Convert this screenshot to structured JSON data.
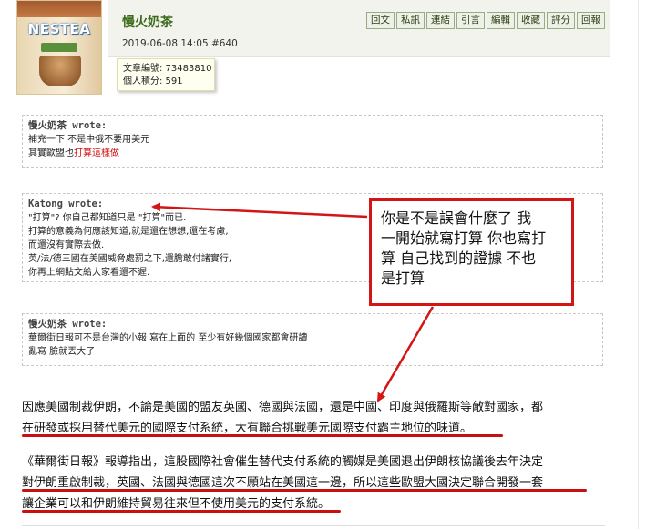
{
  "post": {
    "avatar_brand": "NESTEA",
    "author": "慢火奶茶",
    "meta": "2019-06-08 14:05 #640",
    "info": {
      "article_no": "文章編號: 73483810",
      "score": "個人積分: 591"
    },
    "toolbar": [
      "回文",
      "私訊",
      "連結",
      "引言",
      "編輯",
      "收藏",
      "評分",
      "回報"
    ]
  },
  "quotes": [
    {
      "head": "慢火奶茶 wrote:",
      "lines": [
        "補充一下 不是中俄不要用美元"
      ],
      "last_prefix": "其實歐盟也",
      "last_red": "打算這樣做"
    },
    {
      "head": "Katong wrote:",
      "lines": [
        "\"打算\"? 你自己都知道只是 \"打算\"而已.",
        "打算的意義為何應該知道,就是還在想想,還在考慮,",
        "而還沒有實際去做.",
        "英/法/德三國在美國威脅處罰之下,還膽敢付諸實行,",
        "你再上網貼文給大家看還不遲."
      ]
    },
    {
      "head": "慢火奶茶 wrote:",
      "lines": [
        "華爾街日報可不是台灣的小報 寫在上面的 至少有好幾個國家都會研讀",
        "亂寫 臉就丟大了"
      ]
    }
  ],
  "annotation": {
    "lines": [
      "你是不是誤會什麼了 我",
      "一開始就寫打算 你也寫打",
      "算 自己找到的證據 不也",
      "是打算"
    ],
    "color": "#d41515"
  },
  "article": {
    "p1": [
      "因應美國制裁伊朗，不論是美國的盟友英國、德國與法國，還是中國、印度與俄羅斯等敵對國家，都",
      "在研發或採用替代美元的國際支付系統，大有聯合挑戰美元國際支付霸主地位的味道。"
    ],
    "p2": [
      "《華爾街日報》報導指出，這股國際社會催生替代支付系統的觸媒是美國退出伊朗核協議後去年決定",
      "對伊朗重啟制裁，英國、法國與德國這次不願站在美國這一邊，所以這些歐盟大國決定聯合開發一套",
      "讓企業可以和伊朗維持貿易往來但不使用美元的支付系統。"
    ]
  },
  "colors": {
    "author": "#3c6b1c",
    "accent_red": "#d01010"
  }
}
